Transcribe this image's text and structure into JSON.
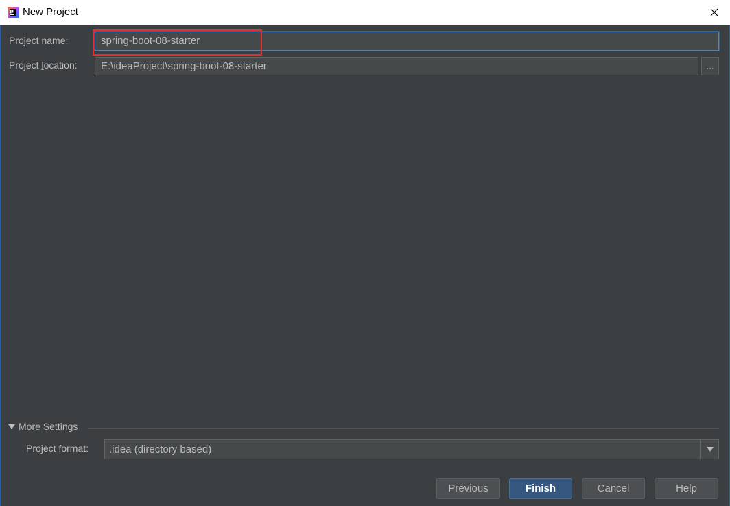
{
  "window": {
    "title": "New Project",
    "close_glyph": "✕"
  },
  "form": {
    "project_name_label_pre": "Project n",
    "project_name_label_ul": "a",
    "project_name_label_post": "me:",
    "project_name_value": "spring-boot-08-starter",
    "project_location_label_pre": "Project ",
    "project_location_label_ul": "l",
    "project_location_label_post": "ocation:",
    "project_location_value": "E:\\ideaProject\\spring-boot-08-starter",
    "browse_label": "..."
  },
  "more_settings": {
    "label_pre": "More Setti",
    "label_ul": "n",
    "label_post": "gs",
    "project_format_label_pre": "Project ",
    "project_format_label_ul": "f",
    "project_format_label_post": "ormat:",
    "project_format_value": ".idea (directory based)"
  },
  "buttons": {
    "previous": "Previous",
    "finish": "Finish",
    "cancel": "Cancel",
    "help": "Help"
  },
  "colors": {
    "background": "#3c3f41",
    "highlight": "#e03030",
    "default_button": "#365880"
  },
  "icons": {
    "app": "intellij-idea-icon",
    "close": "close-icon",
    "expand": "triangle-down-icon",
    "dropdown": "chevron-down-icon"
  }
}
